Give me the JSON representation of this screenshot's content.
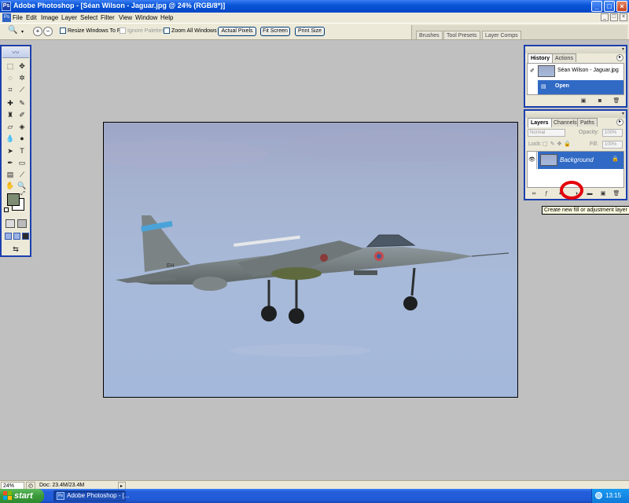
{
  "window": {
    "title": "Adobe Photoshop - [Séan Wilson - Jaguar.jpg @ 24% (RGB/8*)]",
    "app_icon": "photoshop-icon",
    "controls": [
      "_",
      "□",
      "×"
    ]
  },
  "menubar": {
    "items": [
      "File",
      "Edit",
      "Image",
      "Layer",
      "Select",
      "Filter",
      "View",
      "Window",
      "Help"
    ],
    "mdi_controls": [
      "_",
      "□",
      "×"
    ]
  },
  "options": {
    "checkboxes": [
      {
        "label": "Resize Windows To Fit",
        "checked": false,
        "enabled": true
      },
      {
        "label": "Ignore Palettes",
        "checked": false,
        "enabled": false
      },
      {
        "label": "Zoom All Windows",
        "checked": false,
        "enabled": true
      }
    ],
    "buttons": [
      "Actual Pixels",
      "Fit Screen",
      "Print Size"
    ],
    "palette_well_tabs": [
      "Brushes",
      "Tool Presets",
      "Layer Comps"
    ]
  },
  "document": {
    "image_description": "jet-aircraft-photo",
    "tail_code": "EH"
  },
  "history_panel": {
    "tabs": [
      "History",
      "Actions"
    ],
    "snapshot_label": "Séan Wilson - Jaguar.jpg",
    "states": [
      "Open"
    ]
  },
  "layers_panel": {
    "tabs": [
      "Layers",
      "Channels",
      "Paths"
    ],
    "blend_mode": "Normal",
    "opacity_label": "Opacity:",
    "opacity_value": "100%",
    "lock_label": "Lock:",
    "fill_label": "Fill:",
    "fill_value": "100%",
    "layers": [
      {
        "name": "Background",
        "locked": true,
        "visible": true
      }
    ]
  },
  "tooltip": {
    "text": "Create new fill or adjustment layer"
  },
  "statusbar": {
    "zoom": "24%",
    "doc_info": "Doc: 23.4M/23.4M"
  },
  "taskbar": {
    "start_label": "start",
    "task_label": "Adobe Photoshop - [...",
    "clock": "13:15"
  },
  "colors": {
    "foreground": "#7d8c72",
    "background": "#ffffff",
    "selection": "#316ac5",
    "panel_border": "#1c3fae",
    "highlight_circle": "#e4000a"
  }
}
